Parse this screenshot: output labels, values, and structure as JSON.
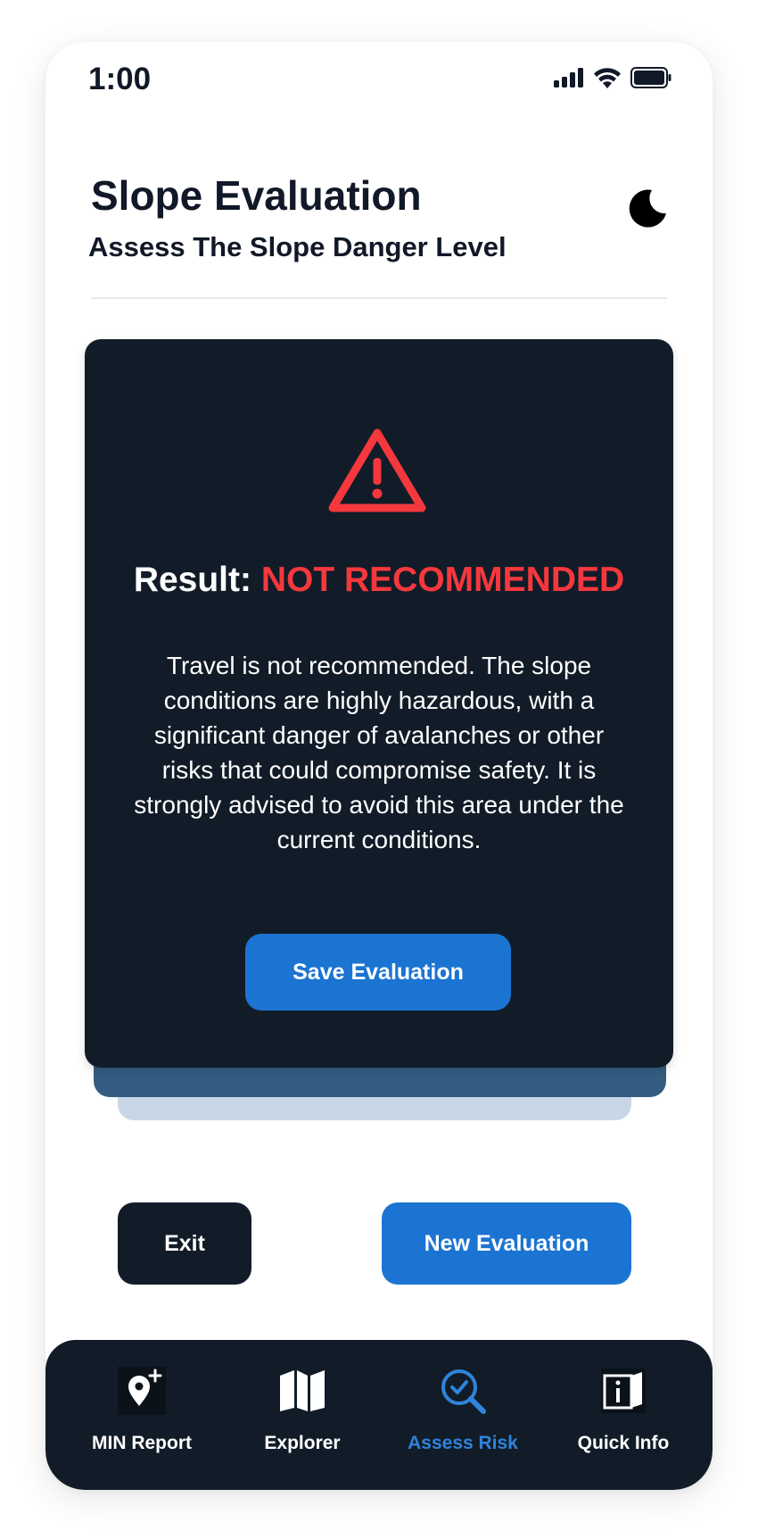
{
  "status_bar": {
    "time": "1:00"
  },
  "header": {
    "title": "Slope Evaluation",
    "subtitle": "Assess The Slope Danger Level",
    "theme_icon": "moon-icon"
  },
  "result": {
    "label": "Result:",
    "value": "NOT RECOMMENDED",
    "description": "Travel is not recommended. The slope conditions are highly hazardous, with a significant danger of avalanches or other risks that could compromise safety. It is strongly advised to avoid this area under the current conditions.",
    "icon": "warning-triangle-icon",
    "save_label": "Save Evaluation"
  },
  "actions": {
    "exit_label": "Exit",
    "new_label": "New Evaluation"
  },
  "nav": {
    "items": [
      {
        "label": "MIN Report",
        "icon": "map-pin-plus-icon",
        "active": false
      },
      {
        "label": "Explorer",
        "icon": "map-icon",
        "active": false
      },
      {
        "label": "Assess Risk",
        "icon": "search-check-icon",
        "active": true
      },
      {
        "label": "Quick Info",
        "icon": "info-book-icon",
        "active": false
      }
    ]
  },
  "colors": {
    "accent": "#1b74d2",
    "danger": "#f5383d",
    "dark": "#111c28"
  }
}
